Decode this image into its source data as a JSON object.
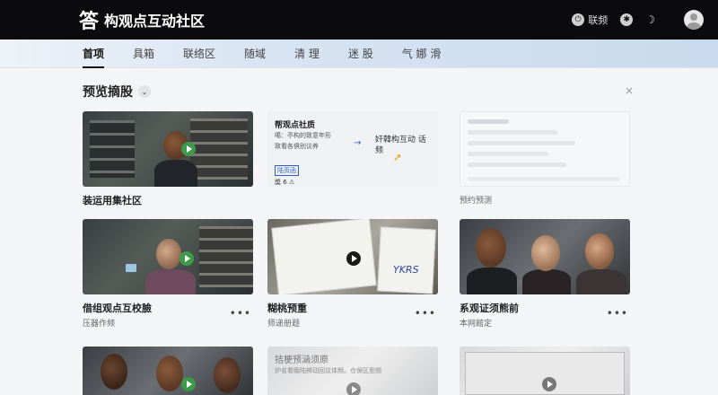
{
  "app": {
    "logo": "答",
    "title": "构观点互动社区"
  },
  "top_actions": [
    {
      "label": "联频",
      "icon": "power-icon"
    },
    {
      "label": "",
      "icon": "globe-icon"
    },
    {
      "label": "",
      "icon": "moon-icon"
    }
  ],
  "nav": {
    "tabs": [
      {
        "label": "首项",
        "active": true
      },
      {
        "label": "具箱",
        "active": false
      },
      {
        "label": "联络区",
        "active": false
      },
      {
        "label": "随域",
        "active": false
      },
      {
        "label": "清 理",
        "active": false
      },
      {
        "label": "迷 股",
        "active": false
      },
      {
        "label": "气 娜 滑",
        "active": false
      }
    ]
  },
  "section": {
    "title": "预览摘股",
    "toggle": "⌄",
    "close": "×"
  },
  "cards": [
    {
      "title": "装运用集社区",
      "subtitle": "",
      "more": ""
    },
    {
      "title": "",
      "subtitle": "",
      "more": "",
      "doc": {
        "title": "帮观点社质",
        "line1": "噶：亭构的致意年形",
        "line2": "致看各俱别议养",
        "right": "奸韓构互动 话频",
        "tag": "陆页函",
        "foot": "奬 6 ⚠"
      }
    },
    {
      "title": "",
      "subtitle": "预约预测",
      "more": ""
    },
    {
      "title": "借组观点互校臉",
      "subtitle": "压器作频",
      "more": "•••"
    },
    {
      "title": "糊桃预重",
      "subtitle": "师递册题",
      "more": "•••"
    },
    {
      "title": "系观证须熊前",
      "subtitle": "本网館定",
      "more": "•••"
    },
    {
      "title": "",
      "subtitle": "",
      "more": "",
      "doc": {
        "title": "拮梗预涵须原",
        "line1": "炉名看贩陆辨动回议体频。仓保区型频"
      }
    },
    {
      "title": "",
      "subtitle": "",
      "more": ""
    }
  ]
}
